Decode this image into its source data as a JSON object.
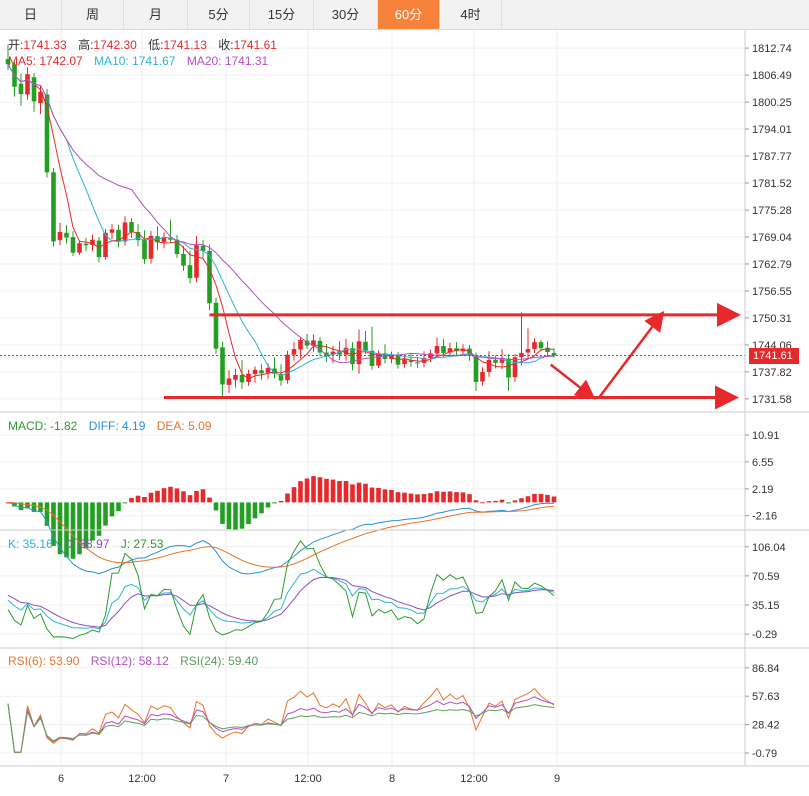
{
  "tabs": [
    "日",
    "周",
    "月",
    "5分",
    "15分",
    "30分",
    "60分",
    "4时"
  ],
  "active_tab": "60分",
  "ohlc_legend": {
    "open_label": "开:",
    "open": "1741.33",
    "high_label": "高:",
    "high": "1742.30",
    "low_label": "低:",
    "low": "1741.13",
    "close_label": "收:",
    "close": "1741.61"
  },
  "ma_legend": [
    {
      "text": "MA5: 1742.07",
      "color": "#e8292b"
    },
    {
      "text": "MA10: 1741.67",
      "color": "#2bb3d6"
    },
    {
      "text": "MA20: 1741.31",
      "color": "#b44fc4"
    }
  ],
  "macd_legend": [
    {
      "text": "MACD: -1.82",
      "color": "#2a9d2a"
    },
    {
      "text": "DIFF: 4.19",
      "color": "#2b8fd6"
    },
    {
      "text": "DEA: 5.09",
      "color": "#e8732b"
    }
  ],
  "kdj_legend": [
    {
      "text": "K: 35.16",
      "color": "#2bb3d6"
    },
    {
      "text": "D: 38.97",
      "color": "#8a4fc4"
    },
    {
      "text": "J: 27.53",
      "color": "#2a9d2a"
    }
  ],
  "rsi_legend": [
    {
      "text": "RSI(6): 53.90",
      "color": "#e8732b"
    },
    {
      "text": "RSI(12): 58.12",
      "color": "#b44fc4"
    },
    {
      "text": "RSI(24): 59.40",
      "color": "#5aa05a"
    }
  ],
  "current_price_tag": "1741.61",
  "colors": {
    "up": "#e8292b",
    "down": "#23a023",
    "accent": "#f6823b",
    "ma5": "#e8292b",
    "ma10": "#2bb3d6",
    "ma20": "#b44fc4"
  },
  "chart_data": {
    "type": "candlestick",
    "x_tick_labels": [
      "6",
      "12:00",
      "7",
      "12:00",
      "8",
      "12:00",
      "9"
    ],
    "price_axis": {
      "ticks": [
        "1812.74",
        "1806.49",
        "1800.25",
        "1794.01",
        "1787.77",
        "1781.52",
        "1775.28",
        "1769.04",
        "1762.79",
        "1756.55",
        "1750.31",
        "1744.06",
        "1737.82",
        "1731.58"
      ],
      "range": [
        1729.0,
        1816.0
      ]
    },
    "macd_axis": {
      "ticks": [
        "10.91",
        "6.55",
        "2.19",
        "-2.16"
      ],
      "range": [
        -3.5,
        13.5
      ]
    },
    "kdj_axis": {
      "ticks": [
        "106.04",
        "70.59",
        "35.15",
        "-0.29"
      ],
      "range": [
        -10,
        118
      ]
    },
    "rsi_axis": {
      "ticks": [
        "86.84",
        "57.63",
        "28.42",
        "-0.79"
      ],
      "range": [
        -8,
        100
      ]
    },
    "candles": [
      [
        1810.2,
        1813.5,
        1807.6,
        1809.0
      ],
      [
        1809.0,
        1810.0,
        1801.5,
        1803.8
      ],
      [
        1804.5,
        1806.8,
        1799.4,
        1802.1
      ],
      [
        1802.0,
        1808.3,
        1800.8,
        1806.7
      ],
      [
        1806.0,
        1807.0,
        1798.0,
        1800.4
      ],
      [
        1800.0,
        1804.0,
        1797.5,
        1802.6
      ],
      [
        1802.0,
        1803.3,
        1782.8,
        1784.0
      ],
      [
        1784.0,
        1785.0,
        1766.8,
        1768.0
      ],
      [
        1768.3,
        1772.3,
        1767.2,
        1770.2
      ],
      [
        1770.0,
        1771.8,
        1767.5,
        1768.9
      ],
      [
        1769.0,
        1770.4,
        1764.6,
        1765.4
      ],
      [
        1765.4,
        1768.2,
        1764.9,
        1767.6
      ],
      [
        1767.5,
        1768.8,
        1765.7,
        1767.1
      ],
      [
        1767.2,
        1769.6,
        1765.8,
        1768.4
      ],
      [
        1768.2,
        1769.0,
        1763.2,
        1764.4
      ],
      [
        1764.4,
        1770.9,
        1763.8,
        1770.0
      ],
      [
        1770.0,
        1772.0,
        1768.5,
        1770.8
      ],
      [
        1770.7,
        1771.9,
        1766.7,
        1767.9
      ],
      [
        1768.0,
        1773.8,
        1767.0,
        1772.4
      ],
      [
        1772.5,
        1773.4,
        1768.8,
        1770.2
      ],
      [
        1770.2,
        1772.0,
        1766.9,
        1768.3
      ],
      [
        1768.4,
        1770.6,
        1762.8,
        1763.9
      ],
      [
        1764.0,
        1770.4,
        1762.9,
        1769.3
      ],
      [
        1769.2,
        1771.5,
        1766.0,
        1767.8
      ],
      [
        1767.9,
        1770.1,
        1766.4,
        1769.0
      ],
      [
        1768.9,
        1773.1,
        1767.7,
        1768.4
      ],
      [
        1768.4,
        1769.5,
        1764.2,
        1765.1
      ],
      [
        1765.1,
        1767.0,
        1761.2,
        1762.4
      ],
      [
        1762.5,
        1765.8,
        1758.3,
        1759.5
      ],
      [
        1759.6,
        1769.3,
        1758.6,
        1767.2
      ],
      [
        1767.0,
        1768.4,
        1763.8,
        1765.8
      ],
      [
        1765.8,
        1767.3,
        1752.1,
        1753.7
      ],
      [
        1753.8,
        1755.0,
        1742.0,
        1743.2
      ],
      [
        1743.5,
        1744.8,
        1731.8,
        1734.9
      ],
      [
        1734.8,
        1738.2,
        1732.9,
        1736.3
      ],
      [
        1736.0,
        1738.6,
        1734.2,
        1737.1
      ],
      [
        1737.1,
        1740.6,
        1733.9,
        1735.4
      ],
      [
        1735.5,
        1738.3,
        1734.6,
        1737.4
      ],
      [
        1737.3,
        1739.1,
        1735.3,
        1738.3
      ],
      [
        1738.2,
        1739.6,
        1736.0,
        1737.5
      ],
      [
        1737.6,
        1739.8,
        1736.2,
        1738.7
      ],
      [
        1738.6,
        1741.2,
        1736.3,
        1737.4
      ],
      [
        1737.3,
        1739.6,
        1734.6,
        1735.8
      ],
      [
        1735.9,
        1742.7,
        1735.1,
        1741.8
      ],
      [
        1741.8,
        1744.7,
        1740.4,
        1743.1
      ],
      [
        1743.0,
        1745.8,
        1741.0,
        1745.2
      ],
      [
        1745.0,
        1746.6,
        1743.1,
        1743.9
      ],
      [
        1743.9,
        1746.5,
        1742.5,
        1745.1
      ],
      [
        1745.0,
        1745.9,
        1741.4,
        1742.3
      ],
      [
        1742.3,
        1744.3,
        1740.1,
        1741.7
      ],
      [
        1741.8,
        1743.8,
        1739.8,
        1742.5
      ],
      [
        1742.6,
        1744.9,
        1740.5,
        1741.8
      ],
      [
        1741.8,
        1745.5,
        1740.4,
        1743.4
      ],
      [
        1743.3,
        1744.7,
        1738.2,
        1739.6
      ],
      [
        1739.6,
        1747.6,
        1737.4,
        1744.9
      ],
      [
        1744.8,
        1747.3,
        1742.0,
        1742.7
      ],
      [
        1742.7,
        1748.3,
        1738.3,
        1739.2
      ],
      [
        1739.3,
        1742.8,
        1738.7,
        1742.1
      ],
      [
        1742.1,
        1744.2,
        1739.8,
        1740.8
      ],
      [
        1740.8,
        1742.5,
        1739.8,
        1741.5
      ],
      [
        1741.5,
        1742.4,
        1738.6,
        1739.5
      ],
      [
        1739.6,
        1741.4,
        1738.8,
        1740.7
      ],
      [
        1740.5,
        1742.1,
        1739.0,
        1740.1
      ],
      [
        1740.0,
        1741.3,
        1738.7,
        1739.9
      ],
      [
        1739.9,
        1742.6,
        1738.9,
        1741.0
      ],
      [
        1741.0,
        1743.0,
        1740.1,
        1742.1
      ],
      [
        1742.1,
        1745.8,
        1741.0,
        1743.8
      ],
      [
        1743.8,
        1745.4,
        1741.3,
        1742.2
      ],
      [
        1742.3,
        1744.6,
        1741.2,
        1743.3
      ],
      [
        1743.3,
        1744.7,
        1741.8,
        1742.6
      ],
      [
        1742.6,
        1744.2,
        1741.5,
        1743.2
      ],
      [
        1743.2,
        1744.0,
        1740.4,
        1741.6
      ],
      [
        1741.5,
        1742.3,
        1733.4,
        1735.5
      ],
      [
        1735.6,
        1738.9,
        1734.6,
        1737.8
      ],
      [
        1737.8,
        1742.6,
        1736.7,
        1740.6
      ],
      [
        1740.6,
        1741.6,
        1738.6,
        1739.9
      ],
      [
        1739.9,
        1743.1,
        1738.4,
        1741.0
      ],
      [
        1740.9,
        1741.9,
        1733.4,
        1736.5
      ],
      [
        1736.6,
        1742.0,
        1735.5,
        1741.2
      ],
      [
        1741.2,
        1751.6,
        1739.3,
        1742.2
      ],
      [
        1742.3,
        1747.9,
        1741.0,
        1743.1
      ],
      [
        1743.1,
        1745.6,
        1742.2,
        1744.7
      ],
      [
        1744.7,
        1745.2,
        1742.6,
        1743.3
      ],
      [
        1743.4,
        1744.9,
        1741.5,
        1742.4
      ],
      [
        1742.2,
        1743.3,
        1741.1,
        1741.6
      ]
    ],
    "annotations": {
      "resistance_line": {
        "from_index": 31,
        "to_index": 90,
        "price": 1751.0
      },
      "support_line": {
        "from_index": 24,
        "to_index": 90,
        "price": 1731.9
      },
      "arrow_down": {
        "from": [
          83.5,
          1739.5
        ],
        "to": [
          89.8,
          1732.1
        ]
      },
      "arrow_up": {
        "from": [
          91.0,
          1732.0
        ],
        "to": [
          100.5,
          1751.0
        ]
      }
    }
  }
}
